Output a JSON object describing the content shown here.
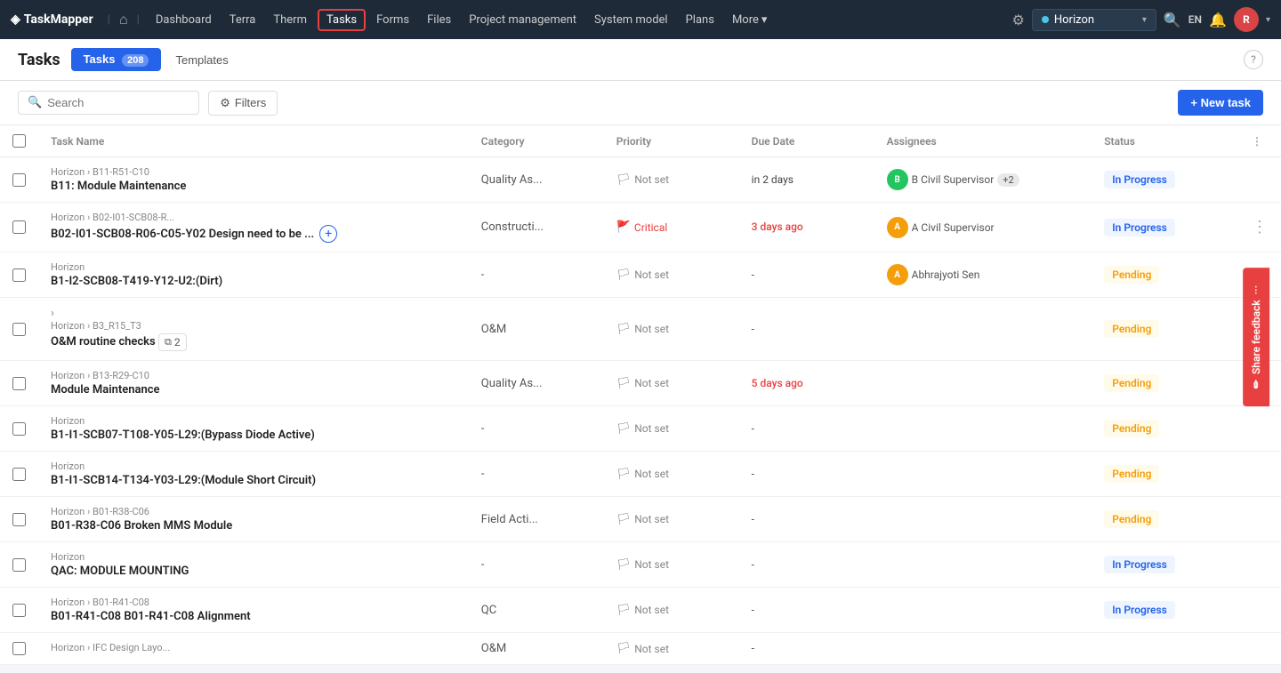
{
  "app": {
    "logo_text": "TaskMapper",
    "logo_icon": "◈"
  },
  "nav": {
    "home_icon": "⌂",
    "items": [
      {
        "label": "Dashboard",
        "active": false
      },
      {
        "label": "Terra",
        "active": false
      },
      {
        "label": "Therm",
        "active": false
      },
      {
        "label": "Tasks",
        "active": true
      },
      {
        "label": "Forms",
        "active": false
      },
      {
        "label": "Files",
        "active": false
      },
      {
        "label": "Project management",
        "active": false
      },
      {
        "label": "System model",
        "active": false
      },
      {
        "label": "Plans",
        "active": false
      },
      {
        "label": "More",
        "active": false
      }
    ],
    "more_suffix": "▾",
    "project": "Horizon",
    "lang": "EN",
    "avatar_initial": "R"
  },
  "page": {
    "title": "Tasks",
    "tabs": [
      {
        "label": "Tasks",
        "badge": "208",
        "active": true
      },
      {
        "label": "Templates",
        "active": false
      }
    ],
    "help_icon": "?"
  },
  "toolbar": {
    "search_placeholder": "Search",
    "filter_label": "Filters",
    "new_task_label": "+ New task"
  },
  "table": {
    "columns": [
      {
        "key": "checkbox",
        "label": ""
      },
      {
        "key": "taskname",
        "label": "Task Name"
      },
      {
        "key": "category",
        "label": "Category"
      },
      {
        "key": "priority",
        "label": "Priority"
      },
      {
        "key": "duedate",
        "label": "Due Date"
      },
      {
        "key": "assignees",
        "label": "Assignees"
      },
      {
        "key": "status",
        "label": "Status"
      },
      {
        "key": "more",
        "label": ""
      }
    ],
    "rows": [
      {
        "id": 1,
        "breadcrumb": "Horizon › B11-R51-C10",
        "taskname": "B11: Module Maintenance",
        "category": "Quality As...",
        "priority": "Not set",
        "priority_critical": false,
        "duedate": "in 2 days",
        "duedate_overdue": false,
        "assignees": [
          {
            "initial": "B",
            "color": "av-green",
            "name": "B Civil Supervisor"
          }
        ],
        "assignee_more": "+2",
        "status": "In Progress",
        "status_class": "status-inprogress",
        "has_more": false,
        "expandable": false
      },
      {
        "id": 2,
        "breadcrumb": "Horizon › B02-I01-SCB08-R...",
        "taskname": "B02-I01-SCB08-R06-C05-Y02 Design need to be ...",
        "category": "Constructi...",
        "priority": "Critical",
        "priority_critical": true,
        "duedate": "3 days ago",
        "duedate_overdue": true,
        "assignees": [
          {
            "initial": "A",
            "color": "av-orange",
            "name": "A Civil Supervisor"
          }
        ],
        "assignee_more": "",
        "status": "In Progress",
        "status_class": "status-inprogress",
        "has_more": true,
        "expandable": false,
        "has_add": true
      },
      {
        "id": 3,
        "breadcrumb": "Horizon",
        "taskname": "B1-I2-SCB08-T419-Y12-U2:(Dirt)",
        "category": "-",
        "priority": "Not set",
        "priority_critical": false,
        "duedate": "-",
        "duedate_overdue": false,
        "assignees": [
          {
            "initial": "A",
            "color": "av-orange",
            "name": "Abhrajyoti Sen"
          }
        ],
        "assignee_more": "",
        "status": "Pending",
        "status_class": "status-pending",
        "has_more": false,
        "expandable": false
      },
      {
        "id": 4,
        "breadcrumb": "Horizon › B3_R15_T3",
        "taskname": "O&M routine checks",
        "category": "O&M",
        "priority": "Not set",
        "priority_critical": false,
        "duedate": "-",
        "duedate_overdue": false,
        "assignees": [],
        "assignee_more": "",
        "status": "Pending",
        "status_class": "status-pending",
        "has_more": false,
        "expandable": true,
        "subtask_count": "2"
      },
      {
        "id": 5,
        "breadcrumb": "Horizon › B13-R29-C10",
        "taskname": "Module Maintenance",
        "category": "Quality As...",
        "priority": "Not set",
        "priority_critical": false,
        "duedate": "5 days ago",
        "duedate_overdue": true,
        "assignees": [],
        "assignee_more": "",
        "status": "Pending",
        "status_class": "status-pending",
        "has_more": false,
        "expandable": false
      },
      {
        "id": 6,
        "breadcrumb": "Horizon",
        "taskname": "B1-I1-SCB07-T108-Y05-L29:(Bypass Diode Active)",
        "category": "-",
        "priority": "Not set",
        "priority_critical": false,
        "duedate": "-",
        "duedate_overdue": false,
        "assignees": [],
        "assignee_more": "",
        "status": "Pending",
        "status_class": "status-pending",
        "has_more": false,
        "expandable": false
      },
      {
        "id": 7,
        "breadcrumb": "Horizon",
        "taskname": "B1-I1-SCB14-T134-Y03-L29:(Module Short Circuit)",
        "category": "-",
        "priority": "Not set",
        "priority_critical": false,
        "duedate": "-",
        "duedate_overdue": false,
        "assignees": [],
        "assignee_more": "",
        "status": "Pending",
        "status_class": "status-pending",
        "has_more": false,
        "expandable": false
      },
      {
        "id": 8,
        "breadcrumb": "Horizon › B01-R38-C06",
        "taskname": "B01-R38-C06 Broken MMS Module",
        "category": "Field Acti...",
        "priority": "Not set",
        "priority_critical": false,
        "duedate": "-",
        "duedate_overdue": false,
        "assignees": [],
        "assignee_more": "",
        "status": "Pending",
        "status_class": "status-pending",
        "has_more": false,
        "expandable": false
      },
      {
        "id": 9,
        "breadcrumb": "Horizon",
        "taskname": "QAC: MODULE MOUNTING",
        "category": "-",
        "priority": "Not set",
        "priority_critical": false,
        "duedate": "-",
        "duedate_overdue": false,
        "assignees": [],
        "assignee_more": "",
        "status": "In Progress",
        "status_class": "status-inprogress",
        "has_more": false,
        "expandable": false
      },
      {
        "id": 10,
        "breadcrumb": "Horizon › B01-R41-C08",
        "taskname": "B01-R41-C08 B01-R41-C08 Alignment",
        "category": "QC",
        "priority": "Not set",
        "priority_critical": false,
        "duedate": "-",
        "duedate_overdue": false,
        "assignees": [],
        "assignee_more": "",
        "status": "In Progress",
        "status_class": "status-inprogress",
        "has_more": false,
        "expandable": false
      },
      {
        "id": 11,
        "breadcrumb": "Horizon › IFC Design Layo...",
        "taskname": "",
        "category": "O&M",
        "priority": "Not set",
        "priority_critical": false,
        "duedate": "-",
        "duedate_overdue": false,
        "assignees": [],
        "assignee_more": "",
        "status": "",
        "status_class": "",
        "has_more": false,
        "expandable": false,
        "partial": true
      }
    ]
  },
  "feedback": {
    "icon": "✏",
    "label": "Share feedback",
    "dots": "···"
  }
}
